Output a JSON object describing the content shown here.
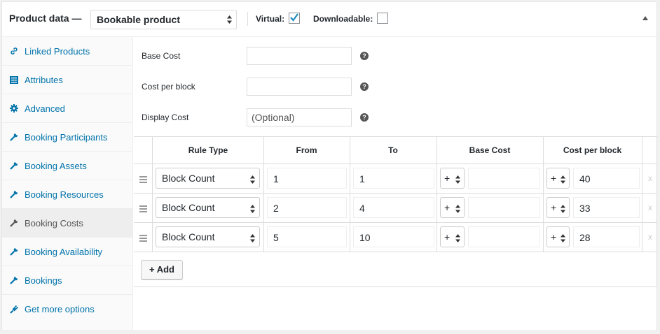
{
  "header": {
    "title": "Product data —",
    "product_type": "Bookable product",
    "virtual_label": "Virtual:",
    "virtual_checked": true,
    "downloadable_label": "Downloadable:",
    "downloadable_checked": false
  },
  "sidebar": {
    "items": [
      {
        "label": "Linked Products",
        "icon": "link-icon"
      },
      {
        "label": "Attributes",
        "icon": "list-icon"
      },
      {
        "label": "Advanced",
        "icon": "gear-icon"
      },
      {
        "label": "Booking Participants",
        "icon": "wrench-icon"
      },
      {
        "label": "Booking Assets",
        "icon": "wrench-icon"
      },
      {
        "label": "Booking Resources",
        "icon": "wrench-icon"
      },
      {
        "label": "Booking Costs",
        "icon": "wrench-icon",
        "active": true
      },
      {
        "label": "Booking Availability",
        "icon": "wrench-icon"
      },
      {
        "label": "Bookings",
        "icon": "wrench-icon"
      },
      {
        "label": "Get more options",
        "icon": "plug-icon"
      }
    ]
  },
  "fields": {
    "base_cost": {
      "label": "Base Cost",
      "value": ""
    },
    "cost_per_block": {
      "label": "Cost per block",
      "value": ""
    },
    "display_cost": {
      "label": "Display Cost",
      "placeholder": "(Optional)"
    }
  },
  "rules": {
    "columns": [
      "Rule Type",
      "From",
      "To",
      "Base Cost",
      "Cost per block"
    ],
    "rows": [
      {
        "type": "Block Count",
        "from": "1",
        "to": "1",
        "base_op": "+",
        "base": "",
        "block_op": "+",
        "block": "40"
      },
      {
        "type": "Block Count",
        "from": "2",
        "to": "4",
        "base_op": "+",
        "base": "",
        "block_op": "+",
        "block": "33"
      },
      {
        "type": "Block Count",
        "from": "5",
        "to": "10",
        "base_op": "+",
        "base": "",
        "block_op": "+",
        "block": "28"
      }
    ],
    "remove_label": "x",
    "add_label": "+ Add"
  },
  "colors": {
    "link": "#0073aa",
    "check": "#1e8cbe"
  }
}
